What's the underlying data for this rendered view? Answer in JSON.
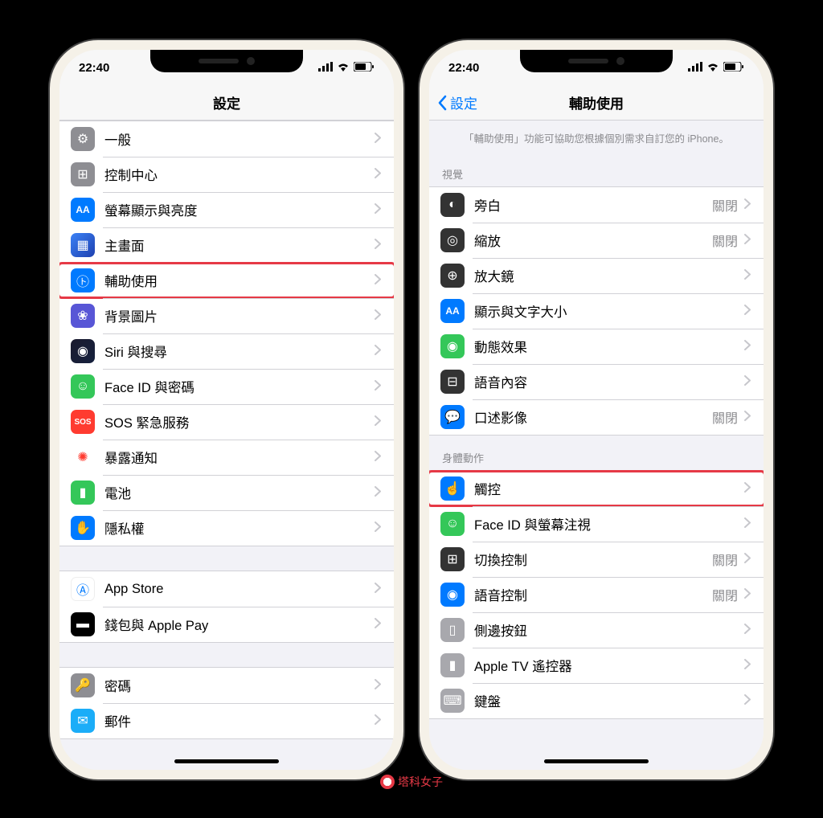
{
  "status": {
    "time": "22:40"
  },
  "left": {
    "title": "設定",
    "groups": [
      {
        "rows": [
          {
            "icon": "gear-icon",
            "bg": "bg-gray",
            "glyph": "⚙",
            "label": "一般"
          },
          {
            "icon": "control-center-icon",
            "bg": "bg-gray",
            "glyph": "⊞",
            "label": "控制中心"
          },
          {
            "icon": "display-icon",
            "bg": "bg-blue",
            "glyph": "AA",
            "label": "螢幕顯示與亮度"
          },
          {
            "icon": "home-screen-icon",
            "bg": "bg-grid",
            "glyph": "▦",
            "label": "主畫面"
          },
          {
            "icon": "accessibility-icon",
            "bg": "bg-blue",
            "glyph": "㋣",
            "label": "輔助使用",
            "highlight": true
          },
          {
            "icon": "wallpaper-icon",
            "bg": "bg-purple",
            "glyph": "❀",
            "label": "背景圖片"
          },
          {
            "icon": "siri-icon",
            "bg": "bg-siri",
            "glyph": "◉",
            "label": "Siri 與搜尋"
          },
          {
            "icon": "faceid-icon",
            "bg": "bg-green",
            "glyph": "☺",
            "label": "Face ID 與密碼"
          },
          {
            "icon": "sos-icon",
            "bg": "bg-sos",
            "glyph": "SOS",
            "label": "SOS 緊急服務"
          },
          {
            "icon": "exposure-icon",
            "bg": "bg-exposure",
            "glyph": "✺",
            "label": "暴露通知"
          },
          {
            "icon": "battery-icon",
            "bg": "bg-green",
            "glyph": "▮",
            "label": "電池"
          },
          {
            "icon": "privacy-icon",
            "bg": "bg-blue",
            "glyph": "✋",
            "label": "隱私權"
          }
        ]
      },
      {
        "rows": [
          {
            "icon": "appstore-icon",
            "bg": "bg-appstore",
            "glyph": "Ⓐ",
            "label": "App Store"
          },
          {
            "icon": "wallet-icon",
            "bg": "bg-wallet",
            "glyph": "▬",
            "label": "錢包與 Apple Pay"
          }
        ]
      },
      {
        "rows": [
          {
            "icon": "passwords-icon",
            "bg": "bg-passwords",
            "glyph": "🔑",
            "label": "密碼"
          },
          {
            "icon": "mail-icon",
            "bg": "bg-mail",
            "glyph": "✉",
            "label": "郵件"
          }
        ]
      }
    ]
  },
  "right": {
    "back": "設定",
    "title": "輔助使用",
    "description": "「輔助使用」功能可協助您根據個別需求自訂您的 iPhone。",
    "sections": [
      {
        "header": "視覺",
        "rows": [
          {
            "icon": "voiceover-icon",
            "bg": "bg-black",
            "glyph": "◐",
            "label": "旁白",
            "value": "關閉"
          },
          {
            "icon": "zoom-icon",
            "bg": "bg-black",
            "glyph": "◎",
            "label": "縮放",
            "value": "關閉"
          },
          {
            "icon": "magnifier-icon",
            "bg": "bg-black",
            "glyph": "⊕",
            "label": "放大鏡"
          },
          {
            "icon": "textsize-icon",
            "bg": "bg-blue",
            "glyph": "AA",
            "label": "顯示與文字大小"
          },
          {
            "icon": "motion-icon",
            "bg": "bg-green",
            "glyph": "◉",
            "label": "動態效果"
          },
          {
            "icon": "spoken-icon",
            "bg": "bg-black",
            "glyph": "⊟",
            "label": "語音內容"
          },
          {
            "icon": "audio-desc-icon",
            "bg": "bg-blue",
            "glyph": "💬",
            "label": "口述影像",
            "value": "關閉"
          }
        ]
      },
      {
        "header": "身體動作",
        "rows": [
          {
            "icon": "touch-icon",
            "bg": "bg-blue",
            "glyph": "☝",
            "label": "觸控",
            "highlight": true
          },
          {
            "icon": "faceid-attention-icon",
            "bg": "bg-green",
            "glyph": "☺",
            "label": "Face ID 與螢幕注視"
          },
          {
            "icon": "switch-control-icon",
            "bg": "bg-black",
            "glyph": "⊞",
            "label": "切換控制",
            "value": "關閉"
          },
          {
            "icon": "voice-control-icon",
            "bg": "bg-blue",
            "glyph": "◉",
            "label": "語音控制",
            "value": "關閉"
          },
          {
            "icon": "side-button-icon",
            "bg": "bg-lightgray",
            "glyph": "▯",
            "label": "側邊按鈕"
          },
          {
            "icon": "appletv-remote-icon",
            "bg": "bg-lightgray",
            "glyph": "▮",
            "label": "Apple TV 遙控器"
          },
          {
            "icon": "keyboard-icon",
            "bg": "bg-lightgray",
            "glyph": "⌨",
            "label": "鍵盤"
          }
        ]
      }
    ]
  },
  "watermark": "塔科女子"
}
